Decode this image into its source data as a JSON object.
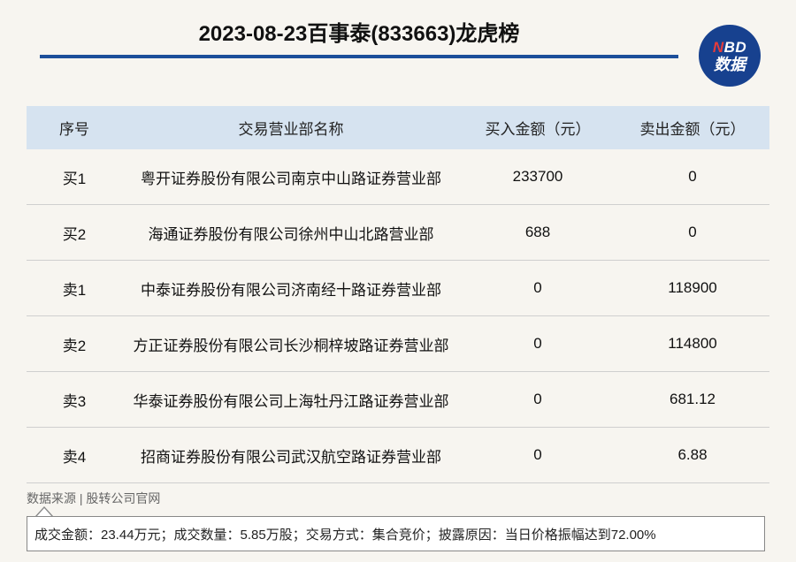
{
  "header": {
    "title": "2023-08-23百事泰(833663)龙虎榜",
    "logo_line1_n": "N",
    "logo_line1_rest": "BD",
    "logo_line2": "数据"
  },
  "table": {
    "columns": [
      "序号",
      "交易营业部名称",
      "买入金额（元）",
      "卖出金额（元）"
    ],
    "rows": [
      {
        "seq": "买1",
        "name": "粤开证券股份有限公司南京中山路证券营业部",
        "buy": "233700",
        "sell": "0"
      },
      {
        "seq": "买2",
        "name": "海通证券股份有限公司徐州中山北路营业部",
        "buy": "688",
        "sell": "0"
      },
      {
        "seq": "卖1",
        "name": "中泰证券股份有限公司济南经十路证券营业部",
        "buy": "0",
        "sell": "118900"
      },
      {
        "seq": "卖2",
        "name": "方正证券股份有限公司长沙桐梓坡路证券营业部",
        "buy": "0",
        "sell": "114800"
      },
      {
        "seq": "卖3",
        "name": "华泰证券股份有限公司上海牡丹江路证券营业部",
        "buy": "0",
        "sell": "681.12"
      },
      {
        "seq": "卖4",
        "name": "招商证券股份有限公司武汉航空路证券营业部",
        "buy": "0",
        "sell": "6.88"
      }
    ]
  },
  "footer": {
    "source": "数据来源 | 股转公司官网",
    "note": "成交金额：23.44万元；成交数量：5.85万股；交易方式：集合竞价；披露原因：当日价格振幅达到72.00%"
  },
  "colors": {
    "accent": "#1d4f9a",
    "logo_bg": "#17418f",
    "header_row_bg": "#d6e3f0",
    "page_bg": "#f7f5f0"
  }
}
